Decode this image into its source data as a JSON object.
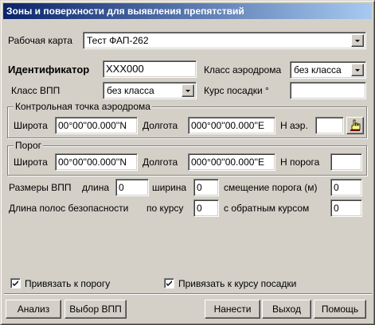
{
  "window": {
    "title": "Зоны и поверхности для выявления препятствий"
  },
  "work_map": {
    "label": "Рабочая карта",
    "value": "Тест ФАП-262"
  },
  "identifier": {
    "label": "Идентификатор",
    "value": "XXX000"
  },
  "aerodrome_class": {
    "label": "Класс аэродрома",
    "value": "без класса"
  },
  "runway_class": {
    "label": "Класс ВПП",
    "value": "без класса"
  },
  "landing_course": {
    "label": "Курс посадки °",
    "value": ""
  },
  "control_point": {
    "title": "Контрольная точка аэродрома",
    "lat_label": "Широта",
    "lat_value": "00°00''00.000''N",
    "lon_label": "Долгота",
    "lon_value": "000°00''00.000''E",
    "h_label": "Н аэр.",
    "h_value": ""
  },
  "threshold": {
    "title": "Порог",
    "lat_label": "Широта",
    "lat_value": "00°00''00.000''N",
    "lon_label": "Долгота",
    "lon_value": "000°00''00.000''E",
    "h_label": "Н порога",
    "h_value": ""
  },
  "runway_dims": {
    "label": "Размеры ВПП",
    "length_label": "длина",
    "length_value": "0",
    "width_label": "ширина",
    "width_value": "0",
    "offset_label": "смещение порога (м)",
    "offset_value": "0"
  },
  "safety_strips": {
    "label": "Длина полос безопасности",
    "forward_label": "по курсу",
    "forward_value": "0",
    "reverse_label": "с обратным курсом",
    "reverse_value": "0"
  },
  "options": {
    "bind_threshold": {
      "label": "Привязать к порогу",
      "checked": true
    },
    "bind_course": {
      "label": "Привязать к курсу посадки",
      "checked": true
    }
  },
  "buttons": {
    "analysis": "Анализ",
    "select_runway": "Выбор ВПП",
    "apply": "Нанести",
    "exit": "Выход",
    "help": "Помощь"
  },
  "icons": {
    "pick_point": "hand-pointer-icon",
    "checkmark": "checkmark-icon",
    "dropdown": "chevron-down-icon"
  }
}
